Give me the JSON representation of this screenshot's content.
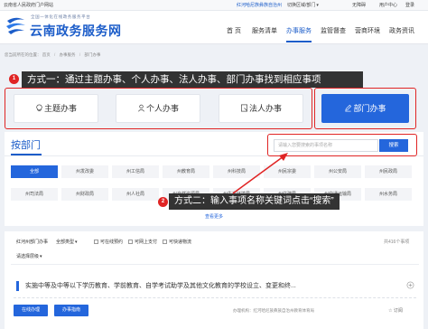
{
  "top_bar": {
    "portal_link": "云南省人民政府门户网站",
    "region": "红河哈尼族彝族自治州",
    "switch_region": "切换区域/部门",
    "accessibility": "无障碍",
    "user_center": "用户中心",
    "login": "登录"
  },
  "header": {
    "subtitle": "全国一体化在线政务服务平台",
    "site_name": "云南政务服务网",
    "nav": [
      "首 页",
      "服务清单",
      "办事服务",
      "监管督查",
      "营商环境",
      "政务资讯"
    ],
    "active_nav": "办事服务"
  },
  "breadcrumb": {
    "prefix": "您当前所在的位置：",
    "items": [
      "首页",
      "办事服务",
      "部门办事"
    ],
    "separator": "/"
  },
  "annotation_1": {
    "badge": "1",
    "text": "方式一：通过主题办事、个人办事、法人办事、部门办事找到相应事项"
  },
  "tabs": [
    {
      "label": "主题办事",
      "icon": "lightbulb-icon"
    },
    {
      "label": "个人办事",
      "icon": "person-icon"
    },
    {
      "label": "法人办事",
      "icon": "document-icon"
    },
    {
      "label": "部门办事",
      "icon": "pen-icon",
      "active": true
    }
  ],
  "department_section": {
    "title": "按部门",
    "search_placeholder": "请输入您要搜索的事项名称",
    "search_button": "搜索",
    "departments": [
      "全部",
      "州发改委",
      "州工信局",
      "州教育局",
      "州科技局",
      "州民宗委",
      "州公安局",
      "州民政局",
      "州司法局",
      "州财政局",
      "州人社局",
      "州自然资源局",
      "州生态环境局",
      "州住建局",
      "州交通运输局",
      "州水务局"
    ],
    "active_department": "全部",
    "more": "查看更多"
  },
  "annotation_2": {
    "badge": "2",
    "text": "方式二：输入事项名称关键词点击“搜索”"
  },
  "filters": {
    "scope": "红河州部门办事",
    "type": "全部类型",
    "options": [
      "可在线预约",
      "可网上支付",
      "可快递物流"
    ],
    "count": "共416个事项",
    "level": "请选择层级"
  },
  "results": [
    {
      "title": "实施中等及中等以下学历教育、学前教育、自学考试助学及其他文化教育的学校设立、变更和终...",
      "online_button": "在线办理",
      "guide_button": "办事指南",
      "org": "办理机构：红河哈尼族彝族自治州教育体育局",
      "subscribe": "订阅"
    }
  ],
  "colors": {
    "primary": "#2466dc",
    "brand": "#1c5dc9",
    "annotation_red": "#e02424",
    "annotation_bg": "#262626"
  }
}
